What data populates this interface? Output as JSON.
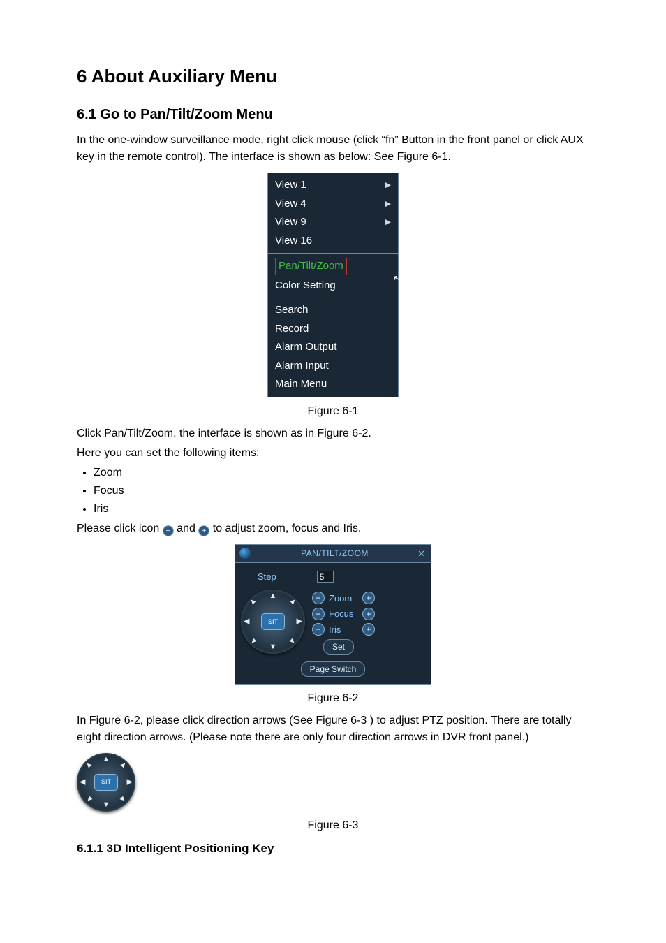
{
  "headings": {
    "chapter": "6  About Auxiliary Menu",
    "section61": "6.1    Go to Pan/Tilt/Zoom Menu",
    "section611": "6.1.1  3D Intelligent Positioning Key"
  },
  "paragraphs": {
    "p1": "In the one-window surveillance mode, right click mouse (click “fn” Button in the front panel or click AUX key in the remote control). The interface is shown as below: See Figure 6-1.",
    "p2": "Click Pan/Tilt/Zoom, the interface is shown as in Figure 6-2.",
    "p3": "Here you can set the following items:",
    "p4a": "Please click icon ",
    "p4b": " and ",
    "p4c": " to adjust zoom, focus and Iris.",
    "p5": "In Figure 6-2, please click direction arrows (See Figure 6-3 ) to adjust PTZ position. There are totally eight direction arrows. (Please note there are only four direction arrows in DVR front panel.)"
  },
  "bullets": {
    "b1": "Zoom",
    "b2": "Focus",
    "b3": "Iris"
  },
  "captions": {
    "fig61": "Figure 6-1",
    "fig62": "Figure 6-2",
    "fig63": "Figure 6-3"
  },
  "contextMenu": {
    "group1": [
      "View 1",
      "View 4",
      "View 9",
      "View 16"
    ],
    "group2": [
      "Pan/Tilt/Zoom",
      "Color Setting"
    ],
    "group3": [
      "Search",
      "Record",
      "Alarm Output",
      "Alarm Input",
      "Main Menu"
    ],
    "submenuArrow": "▶"
  },
  "ptzPanel": {
    "title": "PAN/TILT/ZOOM",
    "stepLabel": "Step",
    "stepValue": "5",
    "rows": {
      "zoom": "Zoom",
      "focus": "Focus",
      "iris": "Iris"
    },
    "setLabel": "Set",
    "pageSwitch": "Page Switch",
    "centerBtn": "SIT",
    "minus": "−",
    "plus": "+"
  }
}
